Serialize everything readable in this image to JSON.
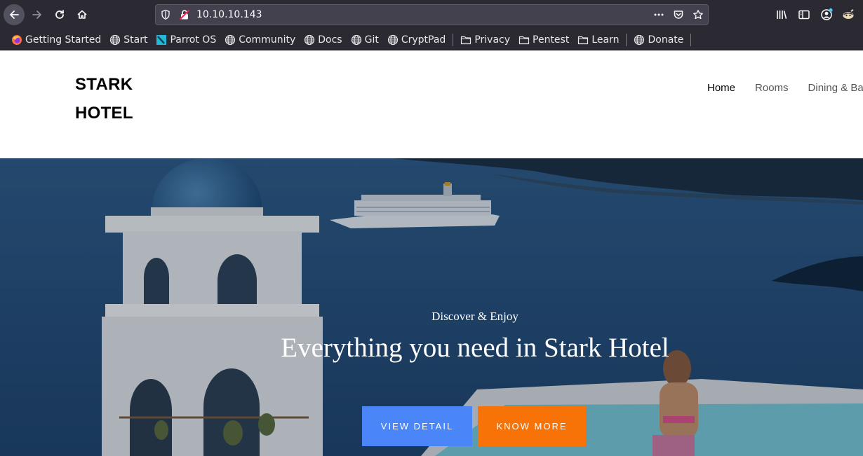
{
  "browser": {
    "url": "10.10.10.143",
    "bookmarks": [
      {
        "label": "Getting Started",
        "icon": "firefox-icon"
      },
      {
        "label": "Start",
        "icon": "globe-icon"
      },
      {
        "label": "Parrot OS",
        "icon": "parrot-icon"
      },
      {
        "label": "Community",
        "icon": "globe-icon"
      },
      {
        "label": "Docs",
        "icon": "globe-icon"
      },
      {
        "label": "Git",
        "icon": "globe-icon"
      },
      {
        "label": "CryptPad",
        "icon": "globe-icon"
      },
      {
        "label": "Privacy",
        "icon": "folder-icon"
      },
      {
        "label": "Pentest",
        "icon": "folder-icon"
      },
      {
        "label": "Learn",
        "icon": "folder-icon"
      },
      {
        "label": "Donate",
        "icon": "globe-icon"
      }
    ]
  },
  "site": {
    "logo_line1": "STARK",
    "logo_line2": "HOTEL",
    "nav": [
      "Home",
      "Rooms",
      "Dining & Bar"
    ],
    "nav_active": "Home"
  },
  "hero": {
    "subtitle": "Discover & Enjoy",
    "title": "Everything you need in Stark Hotel",
    "button_view": "VIEW DETAIL",
    "button_know": "KNOW MORE"
  },
  "colors": {
    "chrome_bg": "#2b2a33",
    "urlbar_bg": "#42414d",
    "view_button": "#4a86f7",
    "know_button": "#f77308"
  }
}
